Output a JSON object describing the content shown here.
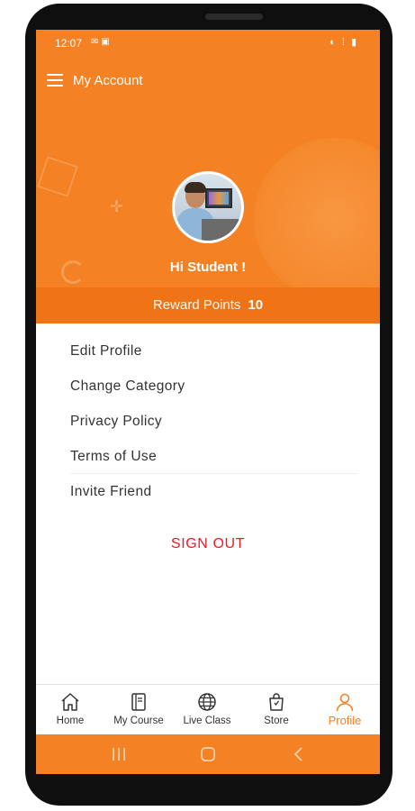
{
  "status_bar": {
    "time": "12:07",
    "left_icons": "✉ ▣",
    "right_icons": "◐ ⁞ ▮"
  },
  "appbar": {
    "title": "My Account"
  },
  "profile": {
    "greeting": "Hi Student !"
  },
  "reward": {
    "label": "Reward Points",
    "value": "10"
  },
  "menu": {
    "items": [
      {
        "label": "Edit Profile"
      },
      {
        "label": "Change Category"
      },
      {
        "label": "Privacy Policy"
      },
      {
        "label": "Terms of Use"
      },
      {
        "label": "Invite Friend"
      }
    ],
    "sign_out": "SIGN OUT"
  },
  "bottom_nav": {
    "items": [
      {
        "label": "Home",
        "icon": "home-icon"
      },
      {
        "label": "My Course",
        "icon": "book-icon"
      },
      {
        "label": "Live Class",
        "icon": "globe-icon"
      },
      {
        "label": "Store",
        "icon": "shopping-bag-icon"
      },
      {
        "label": "Profile",
        "icon": "user-icon"
      }
    ],
    "active": "Profile"
  },
  "colors": {
    "accent": "#f48224",
    "reward_bar": "#f07415",
    "sign_out": "#e41e26"
  }
}
